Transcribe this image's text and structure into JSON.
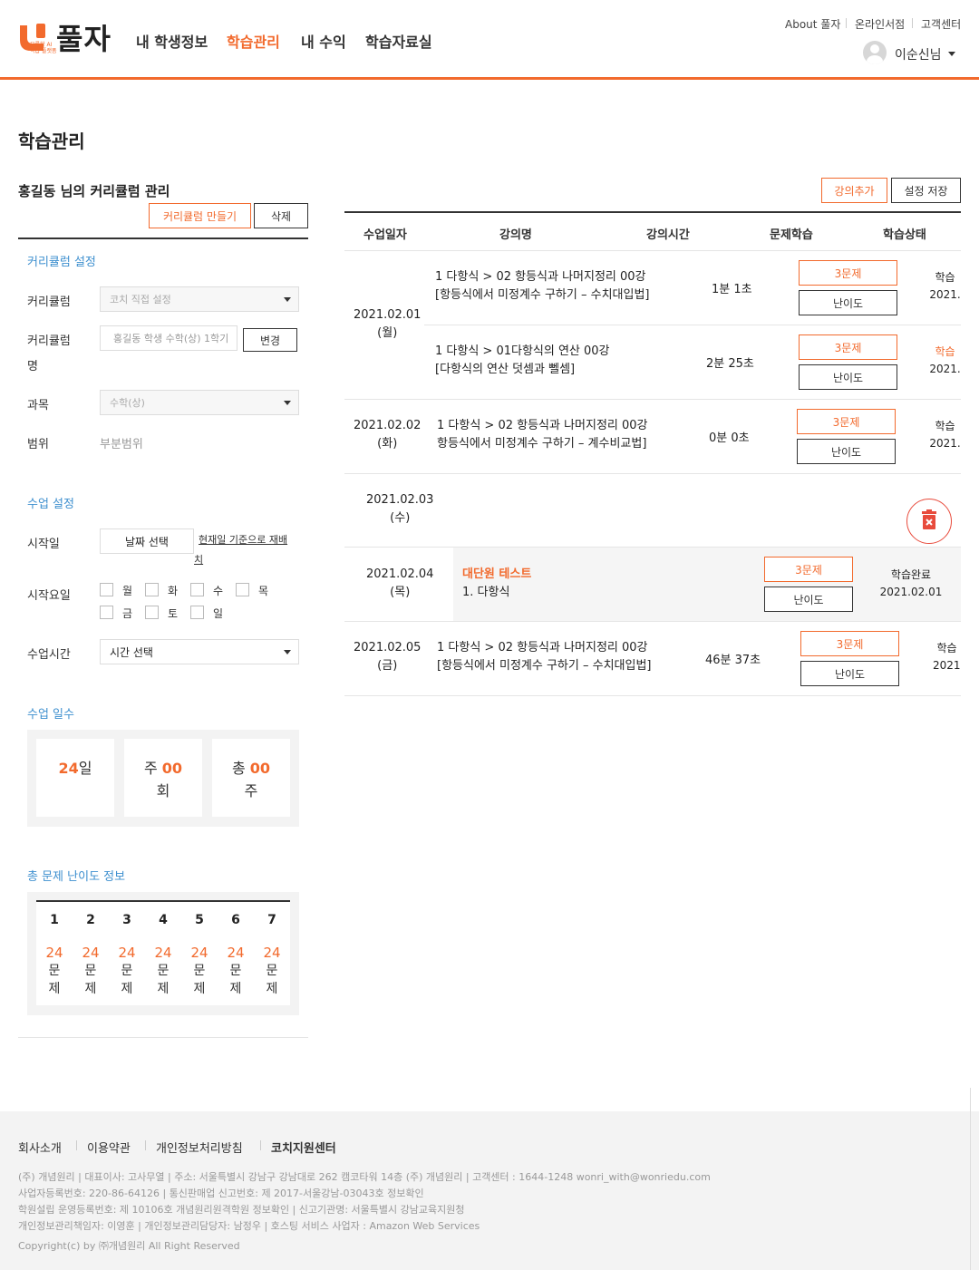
{
  "header": {
    "logo_text": "풀자",
    "logo_sub": "모름학 AI 학습 플랫폼",
    "nav": [
      "내 학생정보",
      "학습관리",
      "내 수익",
      "학습자료실"
    ],
    "active_nav": "학습관리",
    "util_links": [
      "About 풀자",
      "온라인서점",
      "고객센터"
    ],
    "user_name": "이순신님"
  },
  "page": {
    "title": "학습관리",
    "curriculum_title": "홍길동 님의 커리큘럼 관리",
    "create_button": "커리큘럼 만들기",
    "delete_button": "삭제",
    "add_lecture_button": "강의추가",
    "save_settings_button": "설정 저장"
  },
  "curriculum_settings": {
    "heading": "커리큘럼 설정",
    "curriculum_label": "커리큘럼",
    "curriculum_select": "코치 직접 설정",
    "name_label_1": "커리큘럼",
    "name_label_2": "명",
    "name_value": "홍길동 학생 수학(상) 1학기",
    "change_button": "변경",
    "subject_label": "과목",
    "subject_select": "수학(상)",
    "range_label": "범위",
    "range_value": "부분범위"
  },
  "class_settings": {
    "heading": "수업 설정",
    "start_date_label": "시작일",
    "date_select_button": "날짜 선택",
    "reset_link_1": "현재일 기준으로 재배",
    "reset_link_2": "치",
    "start_day_label": "시작요일",
    "days": [
      "월",
      "화",
      "수",
      "목",
      "금",
      "토",
      "일"
    ],
    "class_time_label": "수업시간",
    "time_select": "시간 선택"
  },
  "class_days": {
    "heading": "수업 일수",
    "days_value": "24",
    "days_unit": "일",
    "weekly_prefix": "주 ",
    "weekly_value": "00",
    "weekly_unit": "회",
    "total_prefix": "총 ",
    "total_value": "00",
    "total_unit": "주"
  },
  "difficulty": {
    "heading": "총 문제 난이도 정보",
    "levels": [
      "1",
      "2",
      "3",
      "4",
      "5",
      "6",
      "7"
    ],
    "counts": [
      "24",
      "24",
      "24",
      "24",
      "24",
      "24",
      "24"
    ],
    "unit_1": "문",
    "unit_2": "제"
  },
  "table": {
    "headers": [
      "수업일자",
      "강의명",
      "강의시간",
      "문제학습",
      "학습상태"
    ],
    "rows": [
      {
        "date": "2021.02.01",
        "day": "(월)",
        "lec1": "1 다항식 > 02 항등식과 나머지정리 00강",
        "lec2": "[항등식에서 미정계수 구하기 – 수치대입법]",
        "time": "1분 1초",
        "problem": "3문제",
        "difficulty": "난이도",
        "status1": "학습",
        "status2": "2021."
      },
      {
        "lec1": "1 다항식 > 01다항식의 연산 00강",
        "lec2": "[다항식의 연산 덧셈과 뻴셈]",
        "time": "2분 25초",
        "problem": "3문제",
        "difficulty": "난이도",
        "status1": "학습",
        "status2": "2021."
      },
      {
        "date": "2021.02.02",
        "day": "(화)",
        "lec1": "1 다항식 > 02 항등식과 나머지정리 00강",
        "lec2": "항등식에서 미정계수 구하기 – 계수비교법]",
        "time": "0분 0초",
        "problem": "3문제",
        "difficulty": "난이도",
        "status1": "학습",
        "status2": "2021."
      },
      {
        "date": "2021.02.03",
        "day": "(수)"
      },
      {
        "date": "2021.02.04",
        "day": "(목)",
        "lec1": "대단원 테스트",
        "lec2": "1. 다항식",
        "problem": "3문제",
        "difficulty": "난이도",
        "status1": "학습완료",
        "status2": "2021.02.01"
      },
      {
        "date": "2021.02.05",
        "day": "(금)",
        "lec1": "1 다항식 > 02 항등식과 나머지정리 00강",
        "lec2": "[항등식에서 미정계수 구하기 – 수치대입법]",
        "time": "46분 37초",
        "problem": "3문제",
        "difficulty": "난이도",
        "status1": "학습",
        "status2": "2021."
      }
    ]
  },
  "footer": {
    "links": [
      "회사소개",
      "이용약관",
      "개인정보처리방침",
      "코치지원센터"
    ],
    "info": [
      "(주) 개념원리 | 대표이사: 고사무열 | 주소: 서울특별시 강남구 강남대로 262 캠코타워 14층 (주) 개념원리 | 고객센터 : 1644-1248   wonri_with@wonriedu.com",
      "사업자등록번호: 220-86-64126 | 통신판매업 신고번호: 제 2017-서울강남-03043호 정보확인",
      "학원설립 운영등록번호: 제 10106호 개념원리원격학원 정보확인 | 신고기관명: 서울특별시 강남교육지원청",
      "개인정보관리책임자: 이영훈 | 개인정보관리담당자: 남정우 | 호스팅 서비스 사업자 : Amazon Web Services",
      "Copyright(c) by ㈜개념원리 All Right Reserved"
    ]
  },
  "colors": {
    "accent": "#f26a2d",
    "section_blue": "#3d8fcf",
    "footer_bg": "#f3f3f3"
  }
}
